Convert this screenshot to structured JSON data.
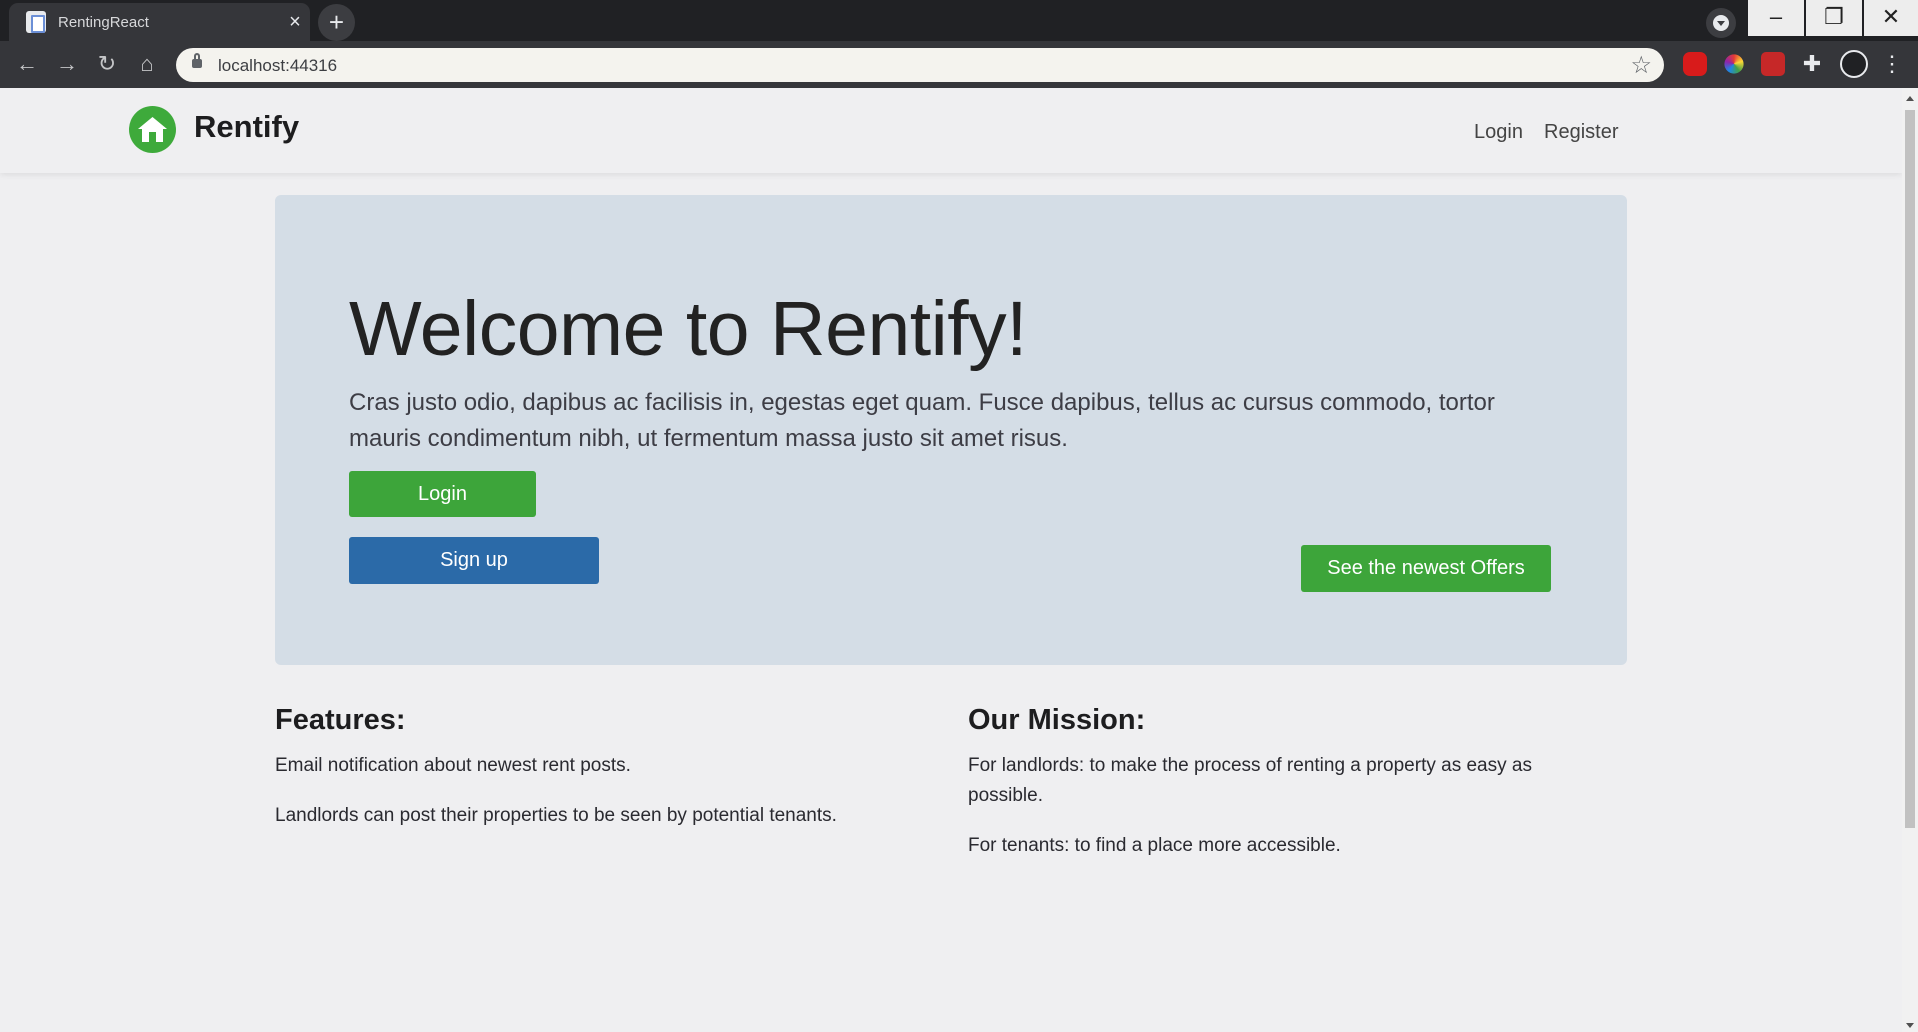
{
  "browser": {
    "tab_title": "RentingReact",
    "url": "localhost:44316"
  },
  "site": {
    "brand": "Rentify",
    "nav": {
      "login": "Login",
      "register": "Register"
    }
  },
  "hero": {
    "heading": "Welcome to Rentify!",
    "lead": "Cras justo odio, dapibus ac facilisis in, egestas eget quam. Fusce dapibus, tellus ac cursus commodo, tortor mauris condimentum nibh, ut fermentum massa justo sit amet risus.",
    "login_button": "Login",
    "signup_button": "Sign up",
    "offers_button": "See the newest Offers"
  },
  "features": {
    "heading": "Features:",
    "items": [
      "Email notification about newest rent posts.",
      "Landlords can post their properties to be seen by potential tenants."
    ]
  },
  "mission": {
    "heading": "Our Mission:",
    "items": [
      "For landlords: to make the process of renting a property as easy as possible.",
      "For tenants: to find a place more accessible."
    ]
  },
  "colors": {
    "green": "#3da53a",
    "blue": "#2b6aa8",
    "jumbotron_bg": "#d4dde6"
  }
}
